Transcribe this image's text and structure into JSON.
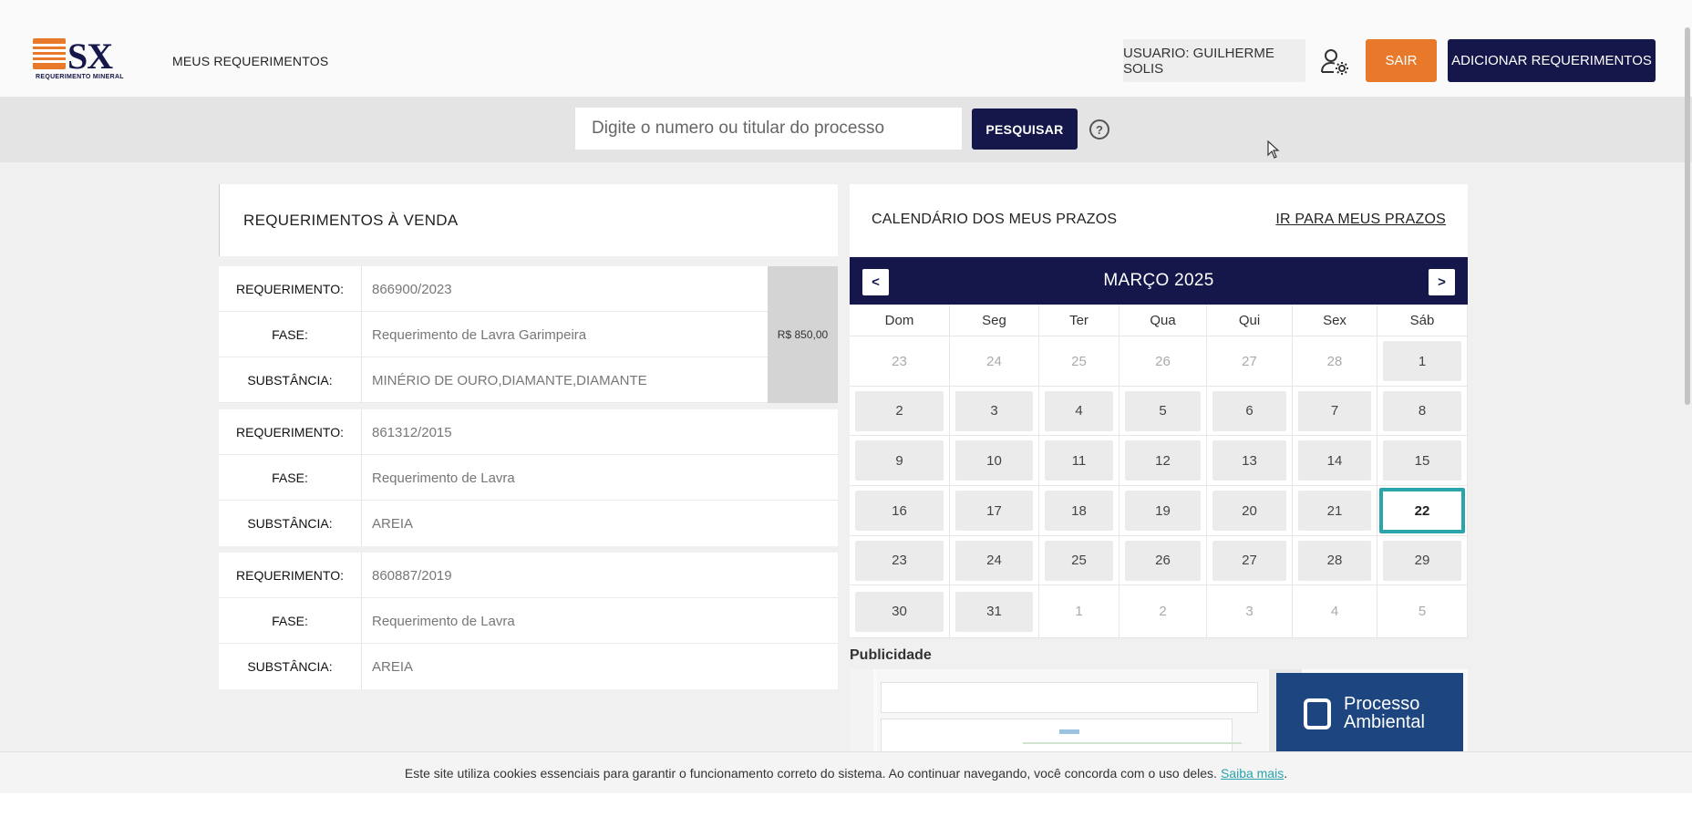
{
  "header": {
    "logo_text": "SX",
    "logo_subtitle": "REQUERIMENTO MINERAL",
    "nav_label": "MEUS REQUERIMENTOS",
    "user_label": "USUARIO: GUILHERME SOLIS",
    "logout_label": "SAIR",
    "add_label": "ADICIONAR REQUERIMENTOS"
  },
  "search": {
    "placeholder": "Digite o numero ou titular do processo",
    "button_label": "PESQUISAR",
    "help_glyph": "?"
  },
  "sales": {
    "title": "REQUERIMENTOS À VENDA",
    "items": [
      {
        "requerimento_label": "REQUERIMENTO:",
        "requerimento": "866900/2023",
        "fase_label": "FASE:",
        "fase": "Requerimento de Lavra Garimpeira",
        "substancia_label": "SUBSTÂNCIA:",
        "substancia": "MINÉRIO DE OURO,DIAMANTE,DIAMANTE",
        "price": "R$ 850,00"
      },
      {
        "requerimento_label": "REQUERIMENTO:",
        "requerimento": "861312/2015",
        "fase_label": "FASE:",
        "fase": "Requerimento de Lavra",
        "substancia_label": "SUBSTÂNCIA:",
        "substancia": "AREIA"
      },
      {
        "requerimento_label": "REQUERIMENTO:",
        "requerimento": "860887/2019",
        "fase_label": "FASE:",
        "fase": "Requerimento de Lavra",
        "substancia_label": "SUBSTÂNCIA:",
        "substancia": "AREIA"
      }
    ]
  },
  "calendar": {
    "title": "CALENDÁRIO DOS MEUS PRAZOS",
    "link_label": "IR PARA MEUS PRAZOS",
    "month_label": "MARÇO 2025",
    "prev_glyph": "<",
    "next_glyph": ">",
    "weekdays": [
      "Dom",
      "Seg",
      "Ter",
      "Qua",
      "Qui",
      "Sex",
      "Sáb"
    ],
    "weeks": [
      [
        [
          "23",
          0
        ],
        [
          "24",
          0
        ],
        [
          "25",
          0
        ],
        [
          "26",
          0
        ],
        [
          "27",
          0
        ],
        [
          "28",
          0
        ],
        [
          "1",
          1
        ]
      ],
      [
        [
          "2",
          1
        ],
        [
          "3",
          1
        ],
        [
          "4",
          1
        ],
        [
          "5",
          1
        ],
        [
          "6",
          1
        ],
        [
          "7",
          1
        ],
        [
          "8",
          1
        ]
      ],
      [
        [
          "9",
          1
        ],
        [
          "10",
          1
        ],
        [
          "11",
          1
        ],
        [
          "12",
          1
        ],
        [
          "13",
          1
        ],
        [
          "14",
          1
        ],
        [
          "15",
          1
        ]
      ],
      [
        [
          "16",
          1
        ],
        [
          "17",
          1
        ],
        [
          "18",
          1
        ],
        [
          "19",
          1
        ],
        [
          "20",
          1
        ],
        [
          "21",
          1
        ],
        [
          "22",
          2
        ]
      ],
      [
        [
          "23",
          1
        ],
        [
          "24",
          1
        ],
        [
          "25",
          1
        ],
        [
          "26",
          1
        ],
        [
          "27",
          1
        ],
        [
          "28",
          1
        ],
        [
          "29",
          1
        ]
      ],
      [
        [
          "30",
          1
        ],
        [
          "31",
          1
        ],
        [
          "1",
          0
        ],
        [
          "2",
          0
        ],
        [
          "3",
          0
        ],
        [
          "4",
          0
        ],
        [
          "5",
          0
        ]
      ]
    ],
    "accent_color": "#2aa4ad"
  },
  "publicidade": {
    "label": "Publicidade",
    "ad_line1": "Processo",
    "ad_line2": "Ambiental"
  },
  "cookie": {
    "text": "Este site utiliza cookies essenciais para garantir o funcionamento correto do sistema. Ao continuar navegando, você concorda com o uso deles.",
    "link": "Saiba mais",
    "tail": "."
  },
  "colors": {
    "brand_navy": "#15174a",
    "brand_orange": "#e8792a"
  }
}
